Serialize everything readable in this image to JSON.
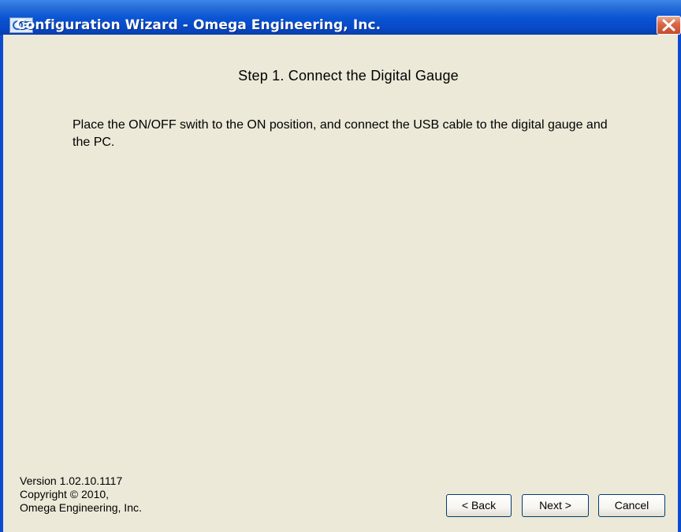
{
  "window": {
    "title": "Configuration Wizard - Omega Engineering, Inc."
  },
  "content": {
    "step_title": "Step 1.  Connect the Digital Gauge",
    "instructions": "Place the ON/OFF swith to the ON position, and connect the USB cable to the digital gauge and the PC."
  },
  "footer": {
    "version": "Version 1.02.10.1117",
    "copyright": "Copyright © 2010,",
    "company": "Omega Engineering, Inc."
  },
  "buttons": {
    "back": "< Back",
    "next": "Next >",
    "cancel": "Cancel"
  },
  "icons": {
    "app": "omega-logo-icon",
    "close": "close-icon"
  },
  "colors": {
    "titlebar": "#0a56d4",
    "close_button": "#d9694a",
    "dialog_background": "#ece9d8"
  }
}
